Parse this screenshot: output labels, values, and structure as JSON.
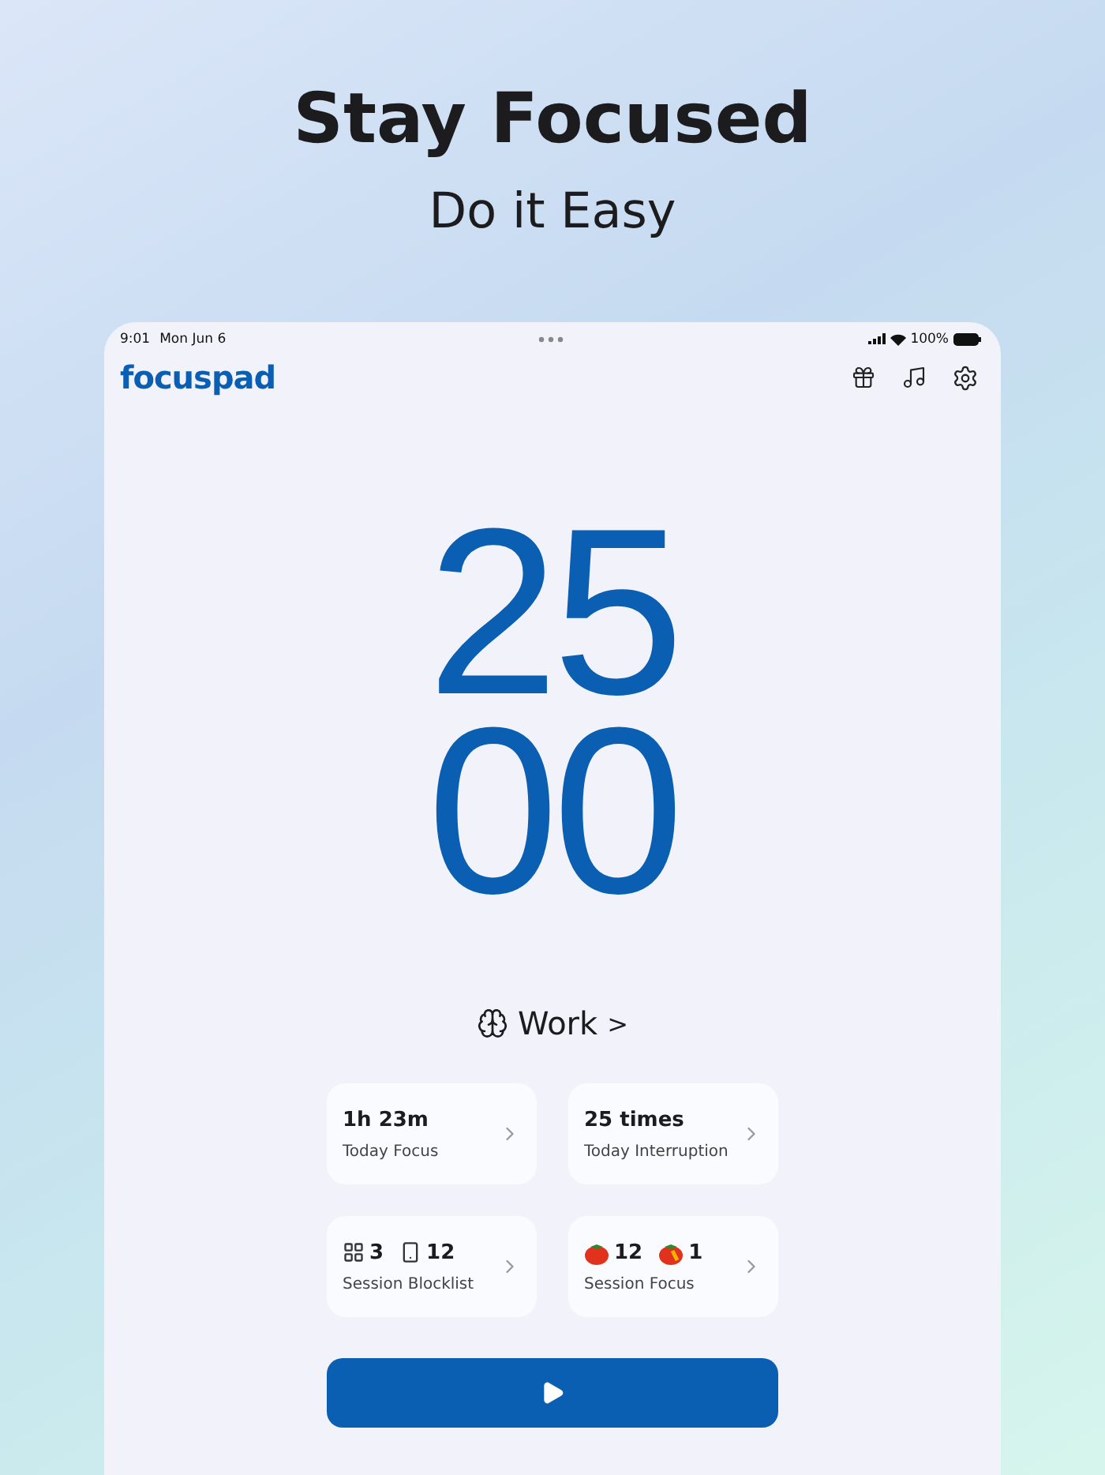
{
  "headline": "Stay Focused",
  "subheadline": "Do it Easy",
  "status_bar": {
    "time": "9:01",
    "date": "Mon Jun 6",
    "battery": "100%"
  },
  "app": {
    "logo": "focuspad"
  },
  "timer": {
    "minutes": "25",
    "seconds": "00"
  },
  "mode": {
    "label": "Work",
    "arrow": ">"
  },
  "cards": [
    {
      "kind": "text",
      "value": "1h 23m",
      "label": "Today Focus"
    },
    {
      "kind": "text",
      "value": "25 times",
      "label": "Today Interruption"
    },
    {
      "kind": "counts",
      "counts": [
        {
          "kind": "apps",
          "value": "3"
        },
        {
          "kind": "phone",
          "value": "12"
        }
      ],
      "label": "Session Blocklist"
    },
    {
      "kind": "counts",
      "counts": [
        {
          "kind": "tomato",
          "value": "12"
        },
        {
          "kind": "broken",
          "value": "1"
        }
      ],
      "label": "Session Focus"
    }
  ]
}
